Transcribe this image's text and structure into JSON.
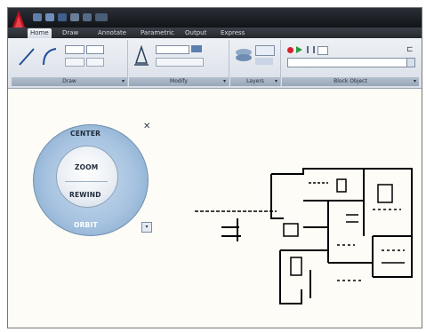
{
  "ribbon_tabs": [
    "Home",
    "Draw",
    "Annotate",
    "Parametric",
    "Output",
    "Express"
  ],
  "active_tab": 0,
  "panels": {
    "draw_label": "Draw",
    "modify_label": "Modify",
    "layers_label": "Layers",
    "view_label": "Block Object"
  },
  "steering_wheel": {
    "top_label": "CENTER",
    "zoom_label": "ZOOM",
    "rewind_label": "REWIND",
    "bottom_label": "ORBIT",
    "close_icon": "close-icon",
    "menu_icon": "chevron-down-icon"
  },
  "colors": {
    "brand_red": "#c0111f",
    "titlebar": "#1c2026",
    "wheel_blue": "#a7c3e0"
  }
}
